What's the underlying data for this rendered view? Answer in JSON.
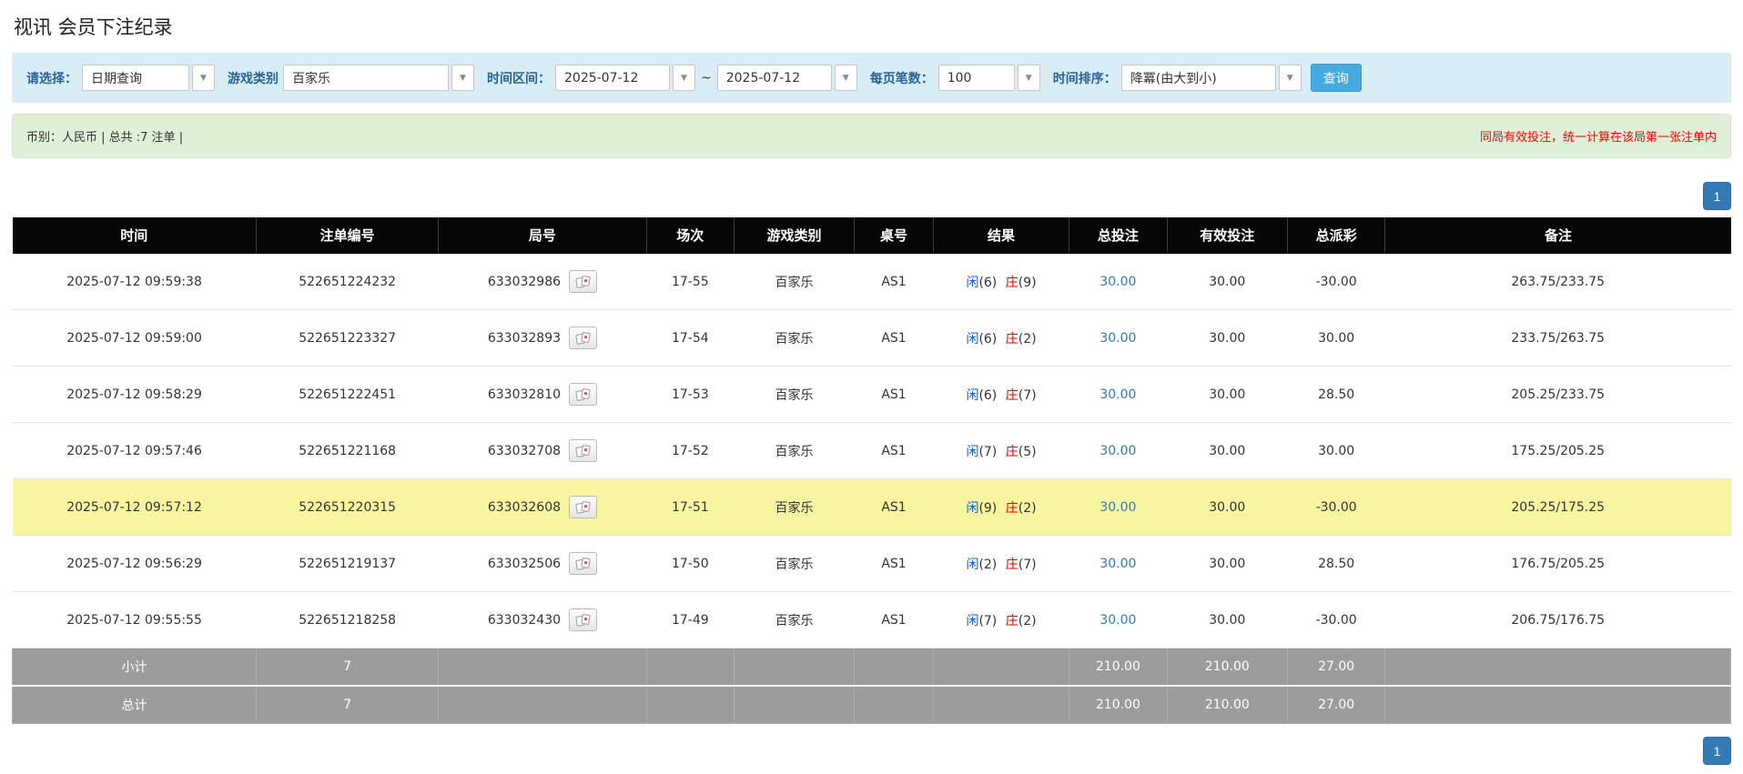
{
  "page": {
    "title": "视讯 会员下注纪录"
  },
  "filters": {
    "select_label": "请选择：",
    "select_value": "日期查询",
    "game_type_label": "游戏类别",
    "game_type_value": "百家乐",
    "date_range_label": "时间区间：",
    "date_from": "2025-07-12",
    "date_separator": "~",
    "date_to": "2025-07-12",
    "page_size_label": "每页笔数：",
    "page_size_value": "100",
    "sort_label": "时间排序：",
    "sort_value": "降冪(由大到小)",
    "search_button": "查询"
  },
  "summary": {
    "left_text": "币别：人民币 | 总共 :7 注单 |",
    "right_note": "同局有效投注，统一计算在该局第一张注单内"
  },
  "pagination": {
    "page": "1"
  },
  "icons": {
    "dropdown_arrow": "▼"
  },
  "table": {
    "headers": [
      "时间",
      "注单编号",
      "局号",
      "场次",
      "游戏类别",
      "桌号",
      "结果",
      "总投注",
      "有效投注",
      "总派彩",
      "备注"
    ],
    "rows": [
      {
        "time": "2025-07-12 09:59:38",
        "bet_no": "522651224232",
        "round_no": "633032986",
        "session": "17-55",
        "game": "百家乐",
        "table_no": "AS1",
        "player": "闲",
        "player_val": "(6)",
        "banker": "庄",
        "banker_val": "(9)",
        "total_bet": "30.00",
        "valid_bet": "30.00",
        "payout": "-30.00",
        "remark": "263.75/233.75",
        "highlight": false
      },
      {
        "time": "2025-07-12 09:59:00",
        "bet_no": "522651223327",
        "round_no": "633032893",
        "session": "17-54",
        "game": "百家乐",
        "table_no": "AS1",
        "player": "闲",
        "player_val": "(6)",
        "banker": "庄",
        "banker_val": "(2)",
        "total_bet": "30.00",
        "valid_bet": "30.00",
        "payout": "30.00",
        "remark": "233.75/263.75",
        "highlight": false
      },
      {
        "time": "2025-07-12 09:58:29",
        "bet_no": "522651222451",
        "round_no": "633032810",
        "session": "17-53",
        "game": "百家乐",
        "table_no": "AS1",
        "player": "闲",
        "player_val": "(6)",
        "banker": "庄",
        "banker_val": "(7)",
        "total_bet": "30.00",
        "valid_bet": "30.00",
        "payout": "28.50",
        "remark": "205.25/233.75",
        "highlight": false
      },
      {
        "time": "2025-07-12 09:57:46",
        "bet_no": "522651221168",
        "round_no": "633032708",
        "session": "17-52",
        "game": "百家乐",
        "table_no": "AS1",
        "player": "闲",
        "player_val": "(7)",
        "banker": "庄",
        "banker_val": "(5)",
        "total_bet": "30.00",
        "valid_bet": "30.00",
        "payout": "30.00",
        "remark": "175.25/205.25",
        "highlight": false
      },
      {
        "time": "2025-07-12 09:57:12",
        "bet_no": "522651220315",
        "round_no": "633032608",
        "session": "17-51",
        "game": "百家乐",
        "table_no": "AS1",
        "player": "闲",
        "player_val": "(9)",
        "banker": "庄",
        "banker_val": "(2)",
        "total_bet": "30.00",
        "valid_bet": "30.00",
        "payout": "-30.00",
        "remark": "205.25/175.25",
        "highlight": true
      },
      {
        "time": "2025-07-12 09:56:29",
        "bet_no": "522651219137",
        "round_no": "633032506",
        "session": "17-50",
        "game": "百家乐",
        "table_no": "AS1",
        "player": "闲",
        "player_val": "(2)",
        "banker": "庄",
        "banker_val": "(7)",
        "total_bet": "30.00",
        "valid_bet": "30.00",
        "payout": "28.50",
        "remark": "176.75/205.25",
        "highlight": false
      },
      {
        "time": "2025-07-12 09:55:55",
        "bet_no": "522651218258",
        "round_no": "633032430",
        "session": "17-49",
        "game": "百家乐",
        "table_no": "AS1",
        "player": "闲",
        "player_val": "(7)",
        "banker": "庄",
        "banker_val": "(2)",
        "total_bet": "30.00",
        "valid_bet": "30.00",
        "payout": "-30.00",
        "remark": "206.75/176.75",
        "highlight": false
      }
    ],
    "subtotal": {
      "label": "小计",
      "count": "7",
      "total_bet": "210.00",
      "valid_bet": "210.00",
      "payout": "27.00"
    },
    "total": {
      "label": "总计",
      "count": "7",
      "total_bet": "210.00",
      "valid_bet": "210.00",
      "payout": "27.00"
    }
  },
  "colors": {
    "filter_bg": "#d9edf7",
    "filter_label": "#2a6496",
    "summary_bg": "#dff0d8",
    "note_red": "#ff0000",
    "header_bg": "#060606",
    "highlight_row": "#f8f5a0",
    "link_blue": "#337ab7",
    "player_blue": "#0a5fd2",
    "banker_red": "#e60000",
    "negative_red": "#e60000",
    "footer_bg": "#9c9c9c",
    "search_button": "#45aade",
    "pagination_active": "#337ab7"
  }
}
